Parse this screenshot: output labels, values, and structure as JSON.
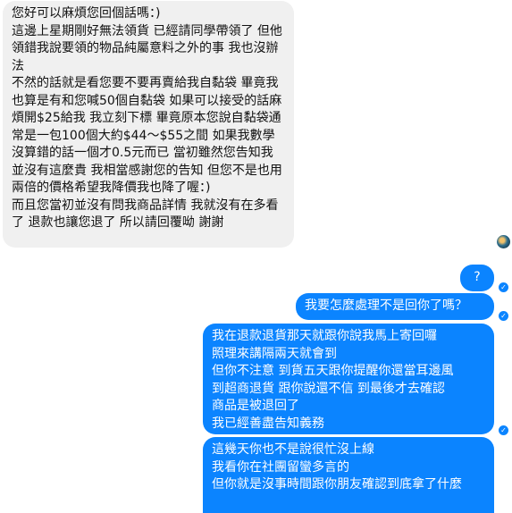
{
  "conversation": {
    "incoming": {
      "message": "您好可以麻煩您回個話嗎：)\n這邊上星期剛好無法領貨 已經請同學帶領了 但他領錯我說要領的物品純屬意料之外的事 我也沒辦法\n不然的話就是看您要不要再賣給我自黏袋 畢竟我也算是有和您喊50個自黏袋 如果可以接受的話麻煩開$25給我 我立刻下標 畢竟原本您說自黏袋通常是一包100個大約$44～$55之間 如果我數學沒算錯的話一個才0.5元而已 當初雖然您告知我並沒有這麼貴 我相當感謝您的告知 但您不是也用兩倍的價格希望我降價我也降了喔：)\n而且您當初並沒有問我商品詳情 我就沒有在多看了 退款也讓您退了 所以請回覆呦 謝謝"
    },
    "outgoing": [
      {
        "text": "?"
      },
      {
        "text": "我要怎麼處理不是回你了嗎？"
      },
      {
        "text": "我在退款退貨那天就跟你說我馬上寄回囉\n照理來講隔兩天就會到\n但你不注意  到貨五天跟你提醒你還當耳邊風\n到超商退貨  跟你說還不信  到最後才去確認\n商品是被退回了\n我已經善盡告知義務"
      },
      {
        "text": "這幾天你也不是說很忙沒上線\n我看你在社團留蠻多言的\n但你就是沒事時間跟你朋友確認到底拿了什麼"
      }
    ],
    "colors": {
      "incoming_bg": "#f0f0f0",
      "outgoing_bg": "#0b84ff"
    },
    "icons": {
      "avatar": "user-avatar-icon",
      "read_receipt": "check-circle-icon"
    }
  }
}
